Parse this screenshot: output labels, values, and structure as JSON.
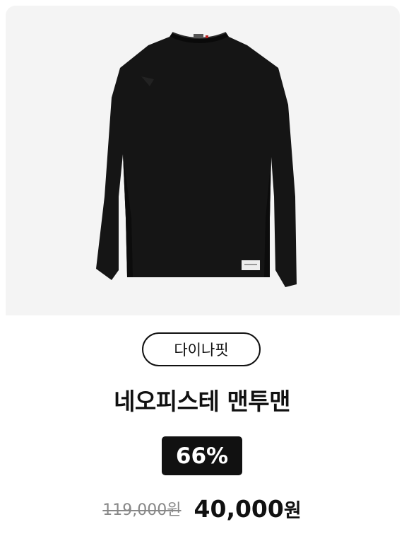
{
  "product": {
    "image_alt": "black long sleeve sweatshirt",
    "brand": "다이나핏",
    "name": "네오피스테 맨투맨",
    "discount": "66%",
    "original_price": "119,000원",
    "sale_price_number": "40,000",
    "sale_price_unit": "원"
  },
  "colors": {
    "image_background": "#f4f4f4",
    "garment": "#141414",
    "text_primary": "#111111",
    "text_muted": "#888888",
    "badge_background": "#111111",
    "badge_text": "#ffffff"
  }
}
